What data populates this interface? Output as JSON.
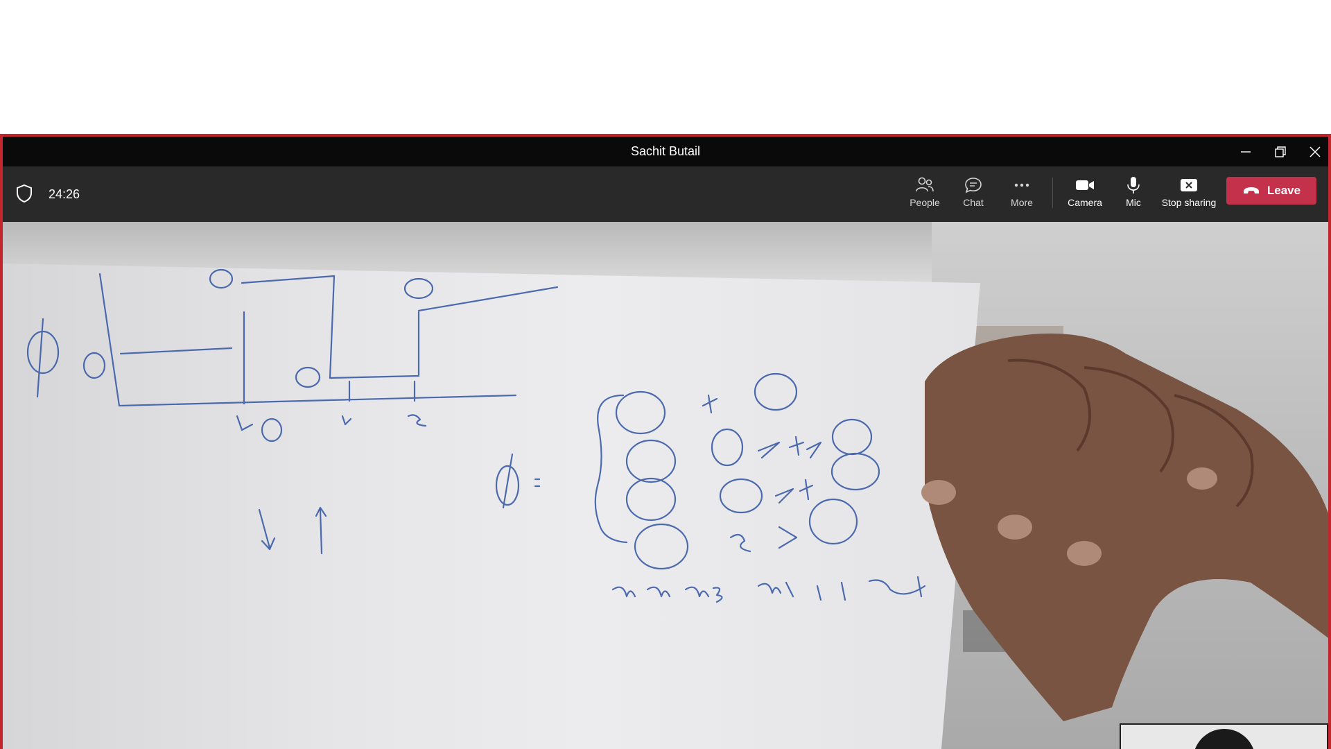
{
  "window": {
    "title": "Sachit Butail"
  },
  "meeting": {
    "elapsed_time": "24:26"
  },
  "toolbar": {
    "people_label": "People",
    "chat_label": "Chat",
    "more_label": "More",
    "camera_label": "Camera",
    "mic_label": "Mic",
    "stop_sharing_label": "Stop sharing",
    "leave_label": "Leave"
  },
  "colors": {
    "window_border": "#c4262e",
    "titlebar": "#0a0a0a",
    "toolbar": "#292929",
    "leave_button": "#c4314b",
    "ink": "#3b5ca8"
  },
  "icons": {
    "shield": "shield-icon",
    "people": "people-icon",
    "chat": "chat-icon",
    "more": "more-icon",
    "camera": "camera-icon",
    "mic": "mic-icon",
    "stop_sharing": "stop-sharing-icon",
    "leave": "phone-hangup-icon",
    "minimize": "minimize-icon",
    "restore": "restore-icon",
    "close": "close-icon"
  }
}
